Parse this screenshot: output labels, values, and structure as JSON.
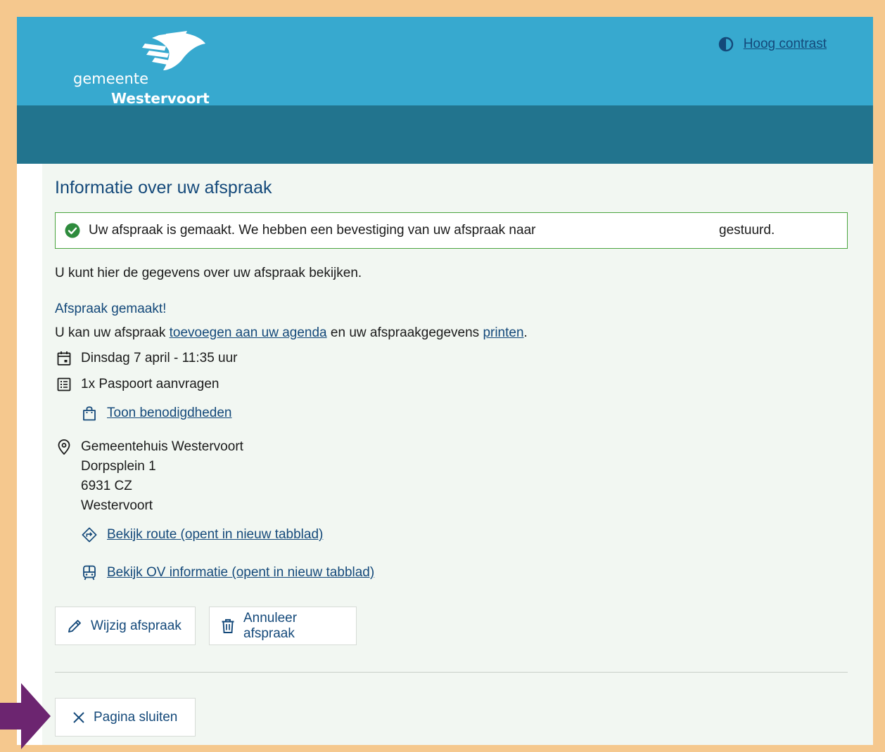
{
  "header": {
    "logo_line1": "gemeente",
    "logo_line2": "Westervoort",
    "contrast_link": "Hoog contrast"
  },
  "page": {
    "title": "Informatie over uw afspraak",
    "alert_text": "Uw afspraak is gemaakt. We hebben een bevestiging van uw afspraak naar",
    "alert_tail": "gestuurd.",
    "intro": "U kunt hier de gegevens over uw afspraak bekijken.",
    "subhead": "Afspraak gemaakt!",
    "agenda_prefix": "U kan uw afspraak ",
    "agenda_link": "toevoegen aan uw agenda",
    "agenda_middle": " en uw afspraakgegevens ",
    "print_link": "printen",
    "agenda_suffix": "."
  },
  "appointment": {
    "datetime": "Dinsdag 7 april - 11:35 uur",
    "product": "1x Paspoort aanvragen",
    "requirements_link": "Toon benodigdheden",
    "location": {
      "name": "Gemeentehuis Westervoort",
      "street": "Dorpsplein 1",
      "postcode": "6931 CZ",
      "city": "Westervoort"
    },
    "route_link": "Bekijk route (opent in nieuw tabblad)",
    "ov_link": "Bekijk OV informatie (opent in nieuw tabblad)"
  },
  "actions": {
    "edit": "Wijzig afspraak",
    "cancel": "Annuleer afspraak",
    "close": "Pagina sluiten"
  },
  "colors": {
    "header": "#37a9cf",
    "band": "#22748e",
    "link": "#14497a",
    "success": "#4aa43e",
    "highlight_border": "#f5c88e",
    "arrow": "#6c2570"
  },
  "icons": [
    "contrast-icon",
    "check-circle-icon",
    "calendar-icon",
    "list-icon",
    "bag-icon",
    "location-pin-icon",
    "route-icon",
    "bus-icon",
    "pencil-icon",
    "trash-icon",
    "close-icon",
    "arrow-right-icon"
  ]
}
